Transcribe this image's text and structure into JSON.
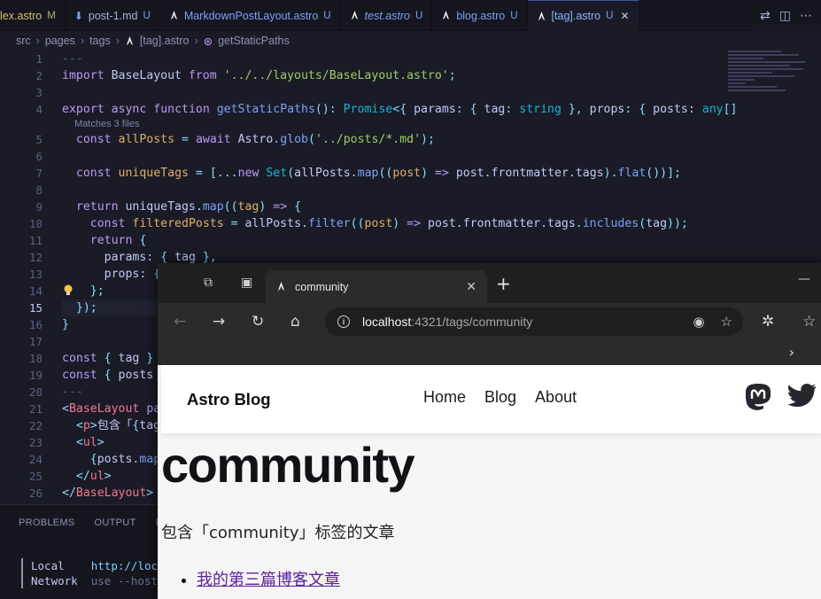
{
  "vscode": {
    "tabs": [
      {
        "label": "lex.astro",
        "status": "M",
        "icon": "astro-icon"
      },
      {
        "label": "post-1.md",
        "status": "U",
        "icon": "markdown-icon"
      },
      {
        "label": "MarkdownPostLayout.astro",
        "status": "U",
        "icon": "astro-icon"
      },
      {
        "label": "test.astro",
        "status": "U",
        "icon": "astro-icon"
      },
      {
        "label": "blog.astro",
        "status": "U",
        "icon": "astro-icon"
      },
      {
        "label": "[tag].astro",
        "status": "U",
        "icon": "astro-icon"
      }
    ],
    "breadcrumb": [
      "src",
      "pages",
      "tags",
      "[tag].astro",
      "getStaticPaths"
    ],
    "codelens": "Matches 3 files",
    "line_numbers": [
      "1",
      "2",
      "3",
      "4",
      "5",
      "6",
      "7",
      "8",
      "9",
      "10",
      "11",
      "12",
      "13",
      "14",
      "15",
      "16",
      "17",
      "18",
      "19",
      "20",
      "21",
      "22",
      "23",
      "24",
      "25",
      "26"
    ],
    "current_line": "15",
    "panel_tabs": [
      "PROBLEMS",
      "OUTPUT",
      "DE"
    ],
    "terminal": {
      "local_label": "Local",
      "local_value": "http://loca",
      "network_label": "Network",
      "network_value": "use --host"
    }
  },
  "browser": {
    "tab_title": "community",
    "url_host": "localhost",
    "url_path": ":4321/tags/community",
    "page": {
      "brand": "Astro Blog",
      "nav": [
        "Home",
        "Blog",
        "About"
      ],
      "heading": "community",
      "description": "包含「community」标签的文章",
      "posts": [
        "我的第三篇博客文章"
      ]
    }
  }
}
